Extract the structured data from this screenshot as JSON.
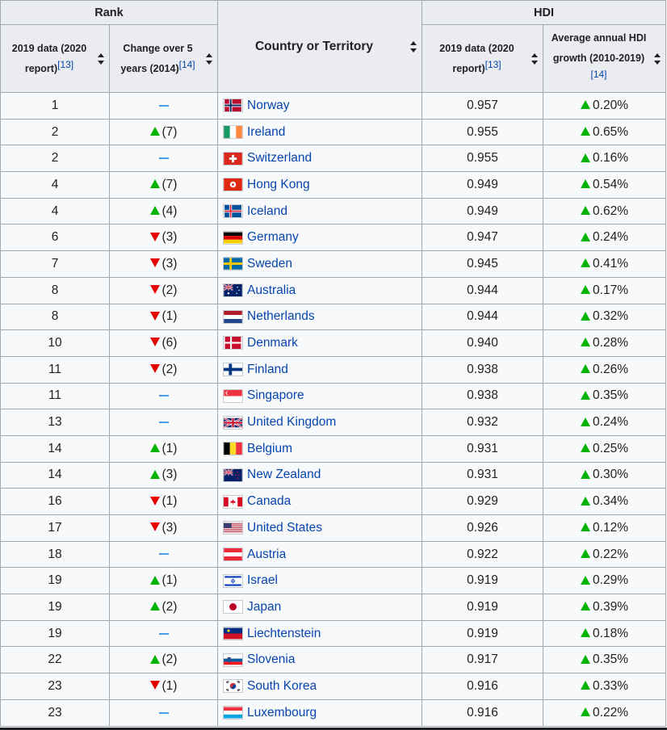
{
  "headers": {
    "rank_group": "Rank",
    "hdi_group": "HDI",
    "rank_2019": "2019 data (2020 report)",
    "rank_2019_ref": "[13]",
    "change": "Change over 5 years (2014)",
    "change_ref": "[14]",
    "country": "Country or Territory",
    "hdi_2019": "2019 data (2020 report)",
    "hdi_2019_ref": "[13]",
    "growth": "Average annual HDI growth (2010-2019)",
    "growth_ref": "[14]"
  },
  "colors": {
    "increase": "#00b300",
    "decrease": "#e60000",
    "steady": "#2b8ce8",
    "link": "#0645ad"
  },
  "rows": [
    {
      "rank": "1",
      "change_dir": "steady",
      "change": "",
      "country": "Norway",
      "flag": "norway-flag",
      "hdi": "0.957",
      "growth": "0.20%"
    },
    {
      "rank": "2",
      "change_dir": "up",
      "change": "(7)",
      "country": "Ireland",
      "flag": "ireland-flag",
      "hdi": "0.955",
      "growth": "0.65%"
    },
    {
      "rank": "2",
      "change_dir": "steady",
      "change": "",
      "country": "Switzerland",
      "flag": "switzerland-flag",
      "hdi": "0.955",
      "growth": "0.16%"
    },
    {
      "rank": "4",
      "change_dir": "up",
      "change": "(7)",
      "country": "Hong Kong",
      "flag": "hong-kong-flag",
      "hdi": "0.949",
      "growth": "0.54%"
    },
    {
      "rank": "4",
      "change_dir": "up",
      "change": "(4)",
      "country": "Iceland",
      "flag": "iceland-flag",
      "hdi": "0.949",
      "growth": "0.62%"
    },
    {
      "rank": "6",
      "change_dir": "down",
      "change": "(3)",
      "country": "Germany",
      "flag": "germany-flag",
      "hdi": "0.947",
      "growth": "0.24%"
    },
    {
      "rank": "7",
      "change_dir": "down",
      "change": "(3)",
      "country": "Sweden",
      "flag": "sweden-flag",
      "hdi": "0.945",
      "growth": "0.41%"
    },
    {
      "rank": "8",
      "change_dir": "down",
      "change": "(2)",
      "country": "Australia",
      "flag": "australia-flag",
      "hdi": "0.944",
      "growth": "0.17%"
    },
    {
      "rank": "8",
      "change_dir": "down",
      "change": "(1)",
      "country": "Netherlands",
      "flag": "netherlands-flag",
      "hdi": "0.944",
      "growth": "0.32%"
    },
    {
      "rank": "10",
      "change_dir": "down",
      "change": "(6)",
      "country": "Denmark",
      "flag": "denmark-flag",
      "hdi": "0.940",
      "growth": "0.28%"
    },
    {
      "rank": "11",
      "change_dir": "down",
      "change": "(2)",
      "country": "Finland",
      "flag": "finland-flag",
      "hdi": "0.938",
      "growth": "0.26%"
    },
    {
      "rank": "11",
      "change_dir": "steady",
      "change": "",
      "country": "Singapore",
      "flag": "singapore-flag",
      "hdi": "0.938",
      "growth": "0.35%"
    },
    {
      "rank": "13",
      "change_dir": "steady",
      "change": "",
      "country": "United Kingdom",
      "flag": "united-kingdom-flag",
      "hdi": "0.932",
      "growth": "0.24%"
    },
    {
      "rank": "14",
      "change_dir": "up",
      "change": "(1)",
      "country": "Belgium",
      "flag": "belgium-flag",
      "hdi": "0.931",
      "growth": "0.25%"
    },
    {
      "rank": "14",
      "change_dir": "up",
      "change": "(3)",
      "country": "New Zealand",
      "flag": "new-zealand-flag",
      "hdi": "0.931",
      "growth": "0.30%"
    },
    {
      "rank": "16",
      "change_dir": "down",
      "change": "(1)",
      "country": "Canada",
      "flag": "canada-flag",
      "hdi": "0.929",
      "growth": "0.34%"
    },
    {
      "rank": "17",
      "change_dir": "down",
      "change": "(3)",
      "country": "United States",
      "flag": "united-states-flag",
      "hdi": "0.926",
      "growth": "0.12%"
    },
    {
      "rank": "18",
      "change_dir": "steady",
      "change": "",
      "country": "Austria",
      "flag": "austria-flag",
      "hdi": "0.922",
      "growth": "0.22%"
    },
    {
      "rank": "19",
      "change_dir": "up",
      "change": "(1)",
      "country": "Israel",
      "flag": "israel-flag",
      "hdi": "0.919",
      "growth": "0.29%"
    },
    {
      "rank": "19",
      "change_dir": "up",
      "change": "(2)",
      "country": "Japan",
      "flag": "japan-flag",
      "hdi": "0.919",
      "growth": "0.39%"
    },
    {
      "rank": "19",
      "change_dir": "steady",
      "change": "",
      "country": "Liechtenstein",
      "flag": "liechtenstein-flag",
      "hdi": "0.919",
      "growth": "0.18%"
    },
    {
      "rank": "22",
      "change_dir": "up",
      "change": "(2)",
      "country": "Slovenia",
      "flag": "slovenia-flag",
      "hdi": "0.917",
      "growth": "0.35%"
    },
    {
      "rank": "23",
      "change_dir": "down",
      "change": "(1)",
      "country": "South Korea",
      "flag": "south-korea-flag",
      "hdi": "0.916",
      "growth": "0.33%"
    },
    {
      "rank": "23",
      "change_dir": "steady",
      "change": "",
      "country": "Luxembourg",
      "flag": "luxembourg-flag",
      "hdi": "0.916",
      "growth": "0.22%"
    }
  ]
}
